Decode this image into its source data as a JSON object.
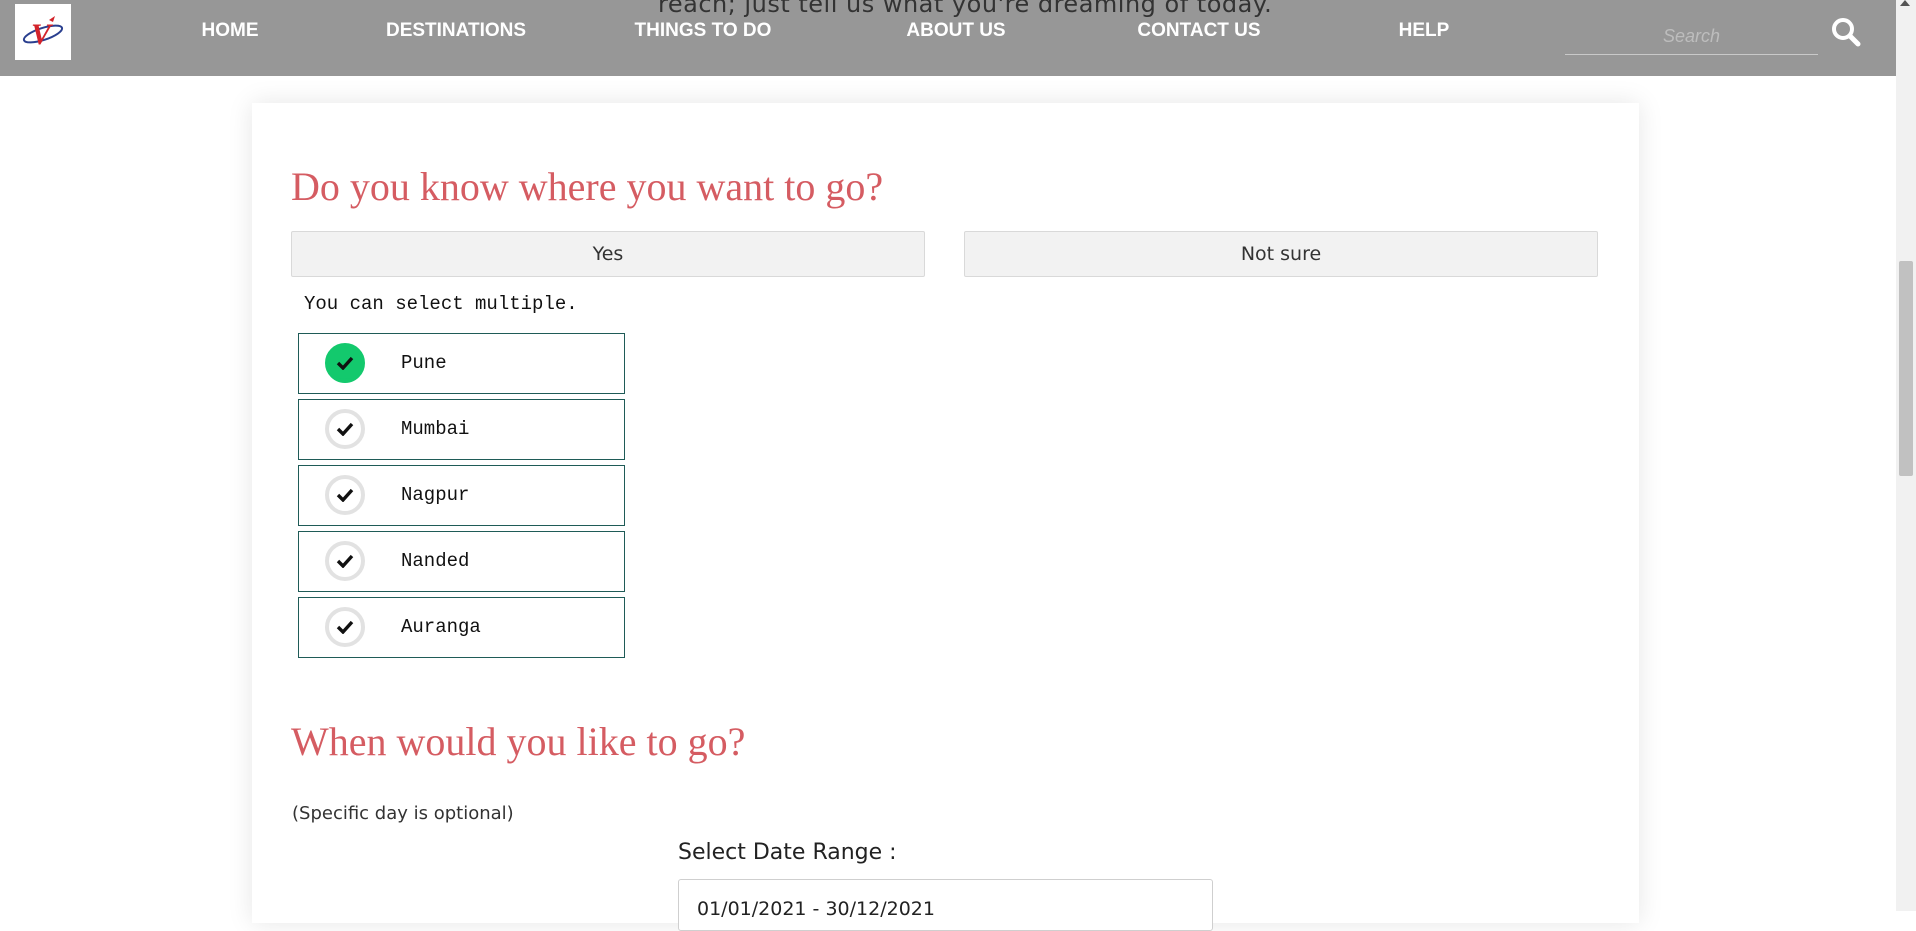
{
  "header": {
    "tagline": "reach; just tell us what you're dreaming of today.",
    "logo_text": "V",
    "nav": [
      {
        "label": "HOME"
      },
      {
        "label": "DESTINATIONS"
      },
      {
        "label": "THINGS TO DO"
      },
      {
        "label": "ABOUT US"
      },
      {
        "label": "CONTACT US"
      },
      {
        "label": "HELP"
      }
    ],
    "search_placeholder": "Search"
  },
  "where": {
    "title": "Do you know where you want to go?",
    "yes_label": "Yes",
    "notsure_label": "Not sure",
    "hint": "You can select multiple.",
    "options": [
      {
        "label": "Pune",
        "selected": true
      },
      {
        "label": "Mumbai",
        "selected": false
      },
      {
        "label": "Nagpur",
        "selected": false
      },
      {
        "label": "Nanded",
        "selected": false
      },
      {
        "label": "Auranga",
        "selected": false
      }
    ]
  },
  "when": {
    "title": "When would you like to go?",
    "subtitle": "(Specific day is optional)",
    "date_label": "Select Date Range :",
    "date_value": "01/01/2021 - 30/12/2021"
  },
  "colors": {
    "accent": "#d55c62",
    "selected": "#13c96d",
    "header_bg": "#979797"
  }
}
